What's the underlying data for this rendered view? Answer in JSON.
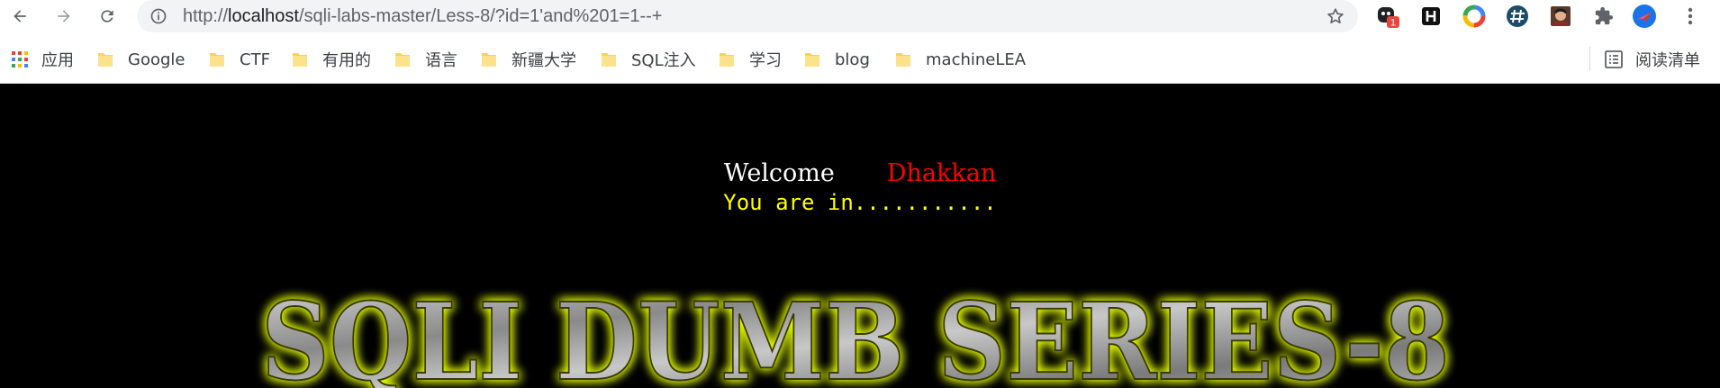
{
  "browser": {
    "url_prefix": "http://",
    "url_host": "localhost",
    "url_path": "/sqli-labs-master/Less-8/?id=1'and%201=1--+",
    "extension_badge": "1",
    "bookmarks": [
      {
        "label": "应用",
        "kind": "apps"
      },
      {
        "label": "Google",
        "kind": "folder"
      },
      {
        "label": "CTF",
        "kind": "folder"
      },
      {
        "label": "有用的",
        "kind": "folder"
      },
      {
        "label": "语言",
        "kind": "folder"
      },
      {
        "label": "新疆大学",
        "kind": "folder"
      },
      {
        "label": "SQL注入",
        "kind": "folder"
      },
      {
        "label": "学习",
        "kind": "folder"
      },
      {
        "label": "blog",
        "kind": "folder"
      },
      {
        "label": "machineLEA",
        "kind": "folder"
      }
    ],
    "reading_list_label": "阅读清单"
  },
  "page": {
    "welcome": "Welcome",
    "name": "Dhakkan",
    "message": "You are in...........",
    "banner_title": "SQLI DUMB SERIES-8"
  },
  "colors": {
    "page_bg": "#000000",
    "welcome": "#ffffff",
    "name": "#ff0000",
    "message": "#ffff00",
    "banner_glow": "#e6ff00"
  }
}
